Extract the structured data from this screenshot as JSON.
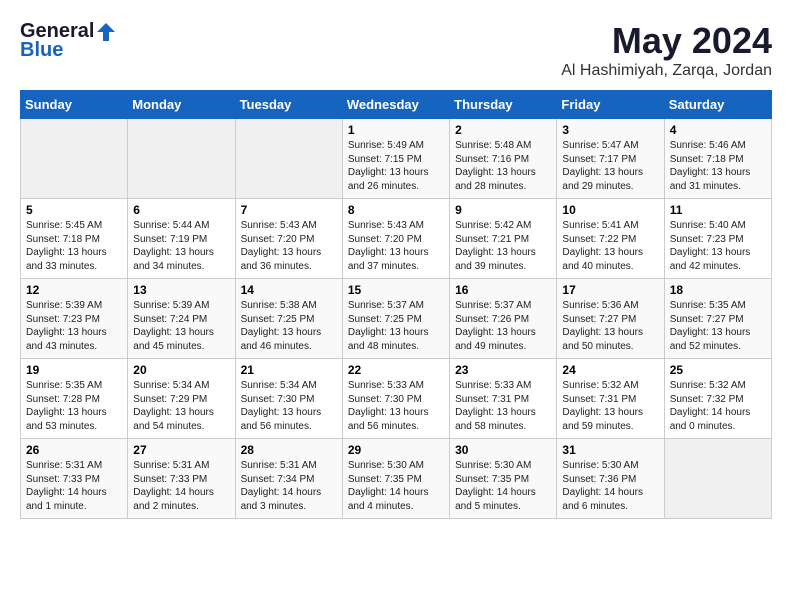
{
  "logo": {
    "general": "General",
    "blue": "Blue"
  },
  "title": "May 2024",
  "location": "Al Hashimiyah, Zarqa, Jordan",
  "weekdays": [
    "Sunday",
    "Monday",
    "Tuesday",
    "Wednesday",
    "Thursday",
    "Friday",
    "Saturday"
  ],
  "weeks": [
    [
      {
        "day": "",
        "info": ""
      },
      {
        "day": "",
        "info": ""
      },
      {
        "day": "",
        "info": ""
      },
      {
        "day": "1",
        "info": "Sunrise: 5:49 AM\nSunset: 7:15 PM\nDaylight: 13 hours\nand 26 minutes."
      },
      {
        "day": "2",
        "info": "Sunrise: 5:48 AM\nSunset: 7:16 PM\nDaylight: 13 hours\nand 28 minutes."
      },
      {
        "day": "3",
        "info": "Sunrise: 5:47 AM\nSunset: 7:17 PM\nDaylight: 13 hours\nand 29 minutes."
      },
      {
        "day": "4",
        "info": "Sunrise: 5:46 AM\nSunset: 7:18 PM\nDaylight: 13 hours\nand 31 minutes."
      }
    ],
    [
      {
        "day": "5",
        "info": "Sunrise: 5:45 AM\nSunset: 7:18 PM\nDaylight: 13 hours\nand 33 minutes."
      },
      {
        "day": "6",
        "info": "Sunrise: 5:44 AM\nSunset: 7:19 PM\nDaylight: 13 hours\nand 34 minutes."
      },
      {
        "day": "7",
        "info": "Sunrise: 5:43 AM\nSunset: 7:20 PM\nDaylight: 13 hours\nand 36 minutes."
      },
      {
        "day": "8",
        "info": "Sunrise: 5:43 AM\nSunset: 7:20 PM\nDaylight: 13 hours\nand 37 minutes."
      },
      {
        "day": "9",
        "info": "Sunrise: 5:42 AM\nSunset: 7:21 PM\nDaylight: 13 hours\nand 39 minutes."
      },
      {
        "day": "10",
        "info": "Sunrise: 5:41 AM\nSunset: 7:22 PM\nDaylight: 13 hours\nand 40 minutes."
      },
      {
        "day": "11",
        "info": "Sunrise: 5:40 AM\nSunset: 7:23 PM\nDaylight: 13 hours\nand 42 minutes."
      }
    ],
    [
      {
        "day": "12",
        "info": "Sunrise: 5:39 AM\nSunset: 7:23 PM\nDaylight: 13 hours\nand 43 minutes."
      },
      {
        "day": "13",
        "info": "Sunrise: 5:39 AM\nSunset: 7:24 PM\nDaylight: 13 hours\nand 45 minutes."
      },
      {
        "day": "14",
        "info": "Sunrise: 5:38 AM\nSunset: 7:25 PM\nDaylight: 13 hours\nand 46 minutes."
      },
      {
        "day": "15",
        "info": "Sunrise: 5:37 AM\nSunset: 7:25 PM\nDaylight: 13 hours\nand 48 minutes."
      },
      {
        "day": "16",
        "info": "Sunrise: 5:37 AM\nSunset: 7:26 PM\nDaylight: 13 hours\nand 49 minutes."
      },
      {
        "day": "17",
        "info": "Sunrise: 5:36 AM\nSunset: 7:27 PM\nDaylight: 13 hours\nand 50 minutes."
      },
      {
        "day": "18",
        "info": "Sunrise: 5:35 AM\nSunset: 7:27 PM\nDaylight: 13 hours\nand 52 minutes."
      }
    ],
    [
      {
        "day": "19",
        "info": "Sunrise: 5:35 AM\nSunset: 7:28 PM\nDaylight: 13 hours\nand 53 minutes."
      },
      {
        "day": "20",
        "info": "Sunrise: 5:34 AM\nSunset: 7:29 PM\nDaylight: 13 hours\nand 54 minutes."
      },
      {
        "day": "21",
        "info": "Sunrise: 5:34 AM\nSunset: 7:30 PM\nDaylight: 13 hours\nand 56 minutes."
      },
      {
        "day": "22",
        "info": "Sunrise: 5:33 AM\nSunset: 7:30 PM\nDaylight: 13 hours\nand 56 minutes."
      },
      {
        "day": "23",
        "info": "Sunrise: 5:33 AM\nSunset: 7:31 PM\nDaylight: 13 hours\nand 58 minutes."
      },
      {
        "day": "24",
        "info": "Sunrise: 5:32 AM\nSunset: 7:31 PM\nDaylight: 13 hours\nand 59 minutes."
      },
      {
        "day": "25",
        "info": "Sunrise: 5:32 AM\nSunset: 7:32 PM\nDaylight: 14 hours\nand 0 minutes."
      }
    ],
    [
      {
        "day": "26",
        "info": "Sunrise: 5:31 AM\nSunset: 7:33 PM\nDaylight: 14 hours\nand 1 minute."
      },
      {
        "day": "27",
        "info": "Sunrise: 5:31 AM\nSunset: 7:33 PM\nDaylight: 14 hours\nand 2 minutes."
      },
      {
        "day": "28",
        "info": "Sunrise: 5:31 AM\nSunset: 7:34 PM\nDaylight: 14 hours\nand 3 minutes."
      },
      {
        "day": "29",
        "info": "Sunrise: 5:30 AM\nSunset: 7:35 PM\nDaylight: 14 hours\nand 4 minutes."
      },
      {
        "day": "30",
        "info": "Sunrise: 5:30 AM\nSunset: 7:35 PM\nDaylight: 14 hours\nand 5 minutes."
      },
      {
        "day": "31",
        "info": "Sunrise: 5:30 AM\nSunset: 7:36 PM\nDaylight: 14 hours\nand 6 minutes."
      },
      {
        "day": "",
        "info": ""
      }
    ]
  ]
}
